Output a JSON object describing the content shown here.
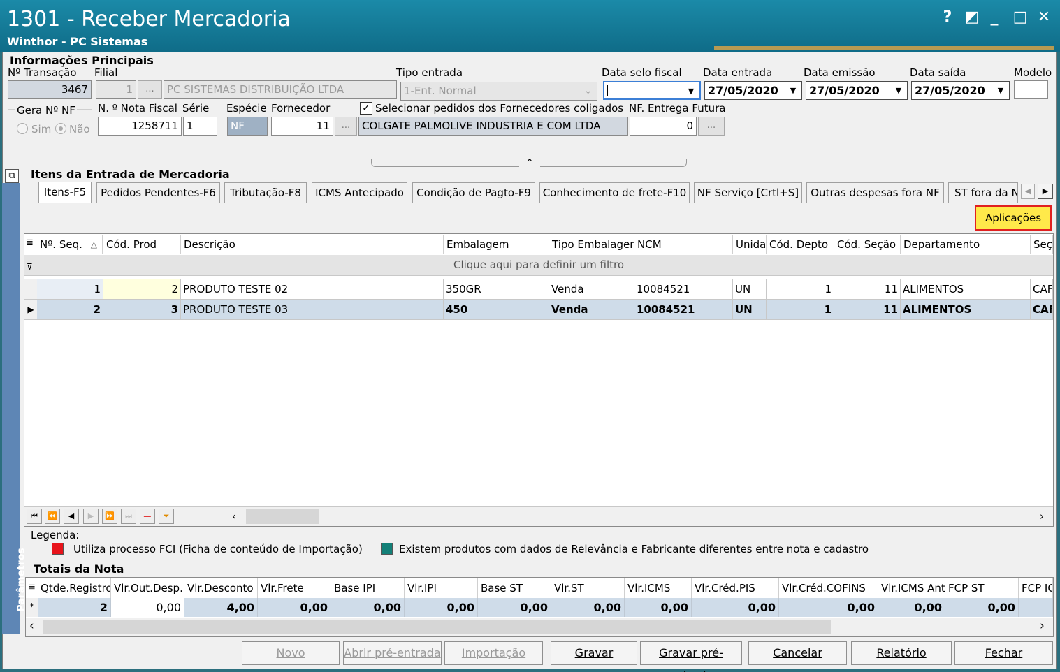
{
  "window": {
    "title": "1301 - Receber Mercadoria",
    "subtitle": "Winthor - PC Sistemas",
    "help": "?",
    "restore": "◩",
    "minimize": "_",
    "maximize": "□",
    "close": "✕"
  },
  "info": {
    "section_title": "Informações Principais",
    "transacao_label": "Nº Transação",
    "transacao_value": "3467",
    "filial_label": "Filial",
    "filial_value": "1",
    "filial_name": "PC SISTEMAS DISTRIBUIÇÃO LTDA",
    "tipo_entrada_label": "Tipo entrada",
    "tipo_entrada_value": "1-Ent. Normal",
    "data_selo_label": "Data selo fiscal",
    "data_selo_value": "",
    "data_entrada_label": "Data entrada",
    "data_entrada_value": "27/05/2020",
    "data_emissao_label": "Data emissão",
    "data_emissao_value": "27/05/2020",
    "data_saida_label": "Data saída",
    "data_saida_value": "27/05/2020",
    "modelo_label": "Modelo",
    "modelo_value": "",
    "gera_nf_label": "Gera Nº NF",
    "sim_label": "Sim",
    "nao_label": "Não",
    "nota_label": "N. º Nota Fiscal",
    "nota_value": "1258711",
    "serie_label": "Série",
    "serie_value": "1",
    "especie_label": "Espécie",
    "especie_value": "NF",
    "fornecedor_label": "Fornecedor",
    "fornecedor_value": "11",
    "fornecedor_name": "COLGATE PALMOLIVE INDUSTRIA  E COM LTDA",
    "coligados_label": "Selecionar pedidos dos Fornecedores coligados",
    "nf_futura_label": "NF. Entrega Futura",
    "nf_futura_value": "0",
    "ellipsis": "..."
  },
  "items": {
    "section_title": "Itens da Entrada de Mercadoria",
    "tabs": [
      "Itens-F5",
      "Pedidos Pendentes-F6",
      "Tributação-F8",
      "ICMS Antecipado",
      "Condição de Pagto-F9",
      "Conhecimento de frete-F10",
      "NF Serviço [Crtl+S]",
      "Outras despesas fora NF",
      "ST fora da N"
    ],
    "aplicacoes": "Aplicações",
    "filter_text": "Clique aqui para definir um filtro",
    "columns": [
      "Nº. Seq.",
      "Cód. Prod",
      "Descrição",
      "Embalagem",
      "Tipo Embalagem",
      "NCM",
      "Unida",
      "Cód. Depto",
      "Cód. Seção",
      "Departamento",
      "Seç"
    ],
    "rows": [
      [
        "1",
        "2",
        "PRODUTO TESTE 02",
        "350GR",
        "Venda",
        "10084521",
        "UN",
        "1",
        "11",
        "ALIMENTOS",
        "CAF"
      ],
      [
        "2",
        "3",
        "PRODUTO TESTE 03",
        "450",
        "Venda",
        "10084521",
        "UN",
        "1",
        "11",
        "ALIMENTOS",
        "CAF"
      ]
    ]
  },
  "legend": {
    "title": "Legenda:",
    "fci": "Utiliza processo FCI (Ficha de conteúdo de Importação)",
    "relevancia": "Existem produtos com dados de Relevância e Fabricante diferentes entre nota e cadastro",
    "fci_color": "#e8141b",
    "relevancia_color": "#138078"
  },
  "totais": {
    "title": "Totais da Nota",
    "columns": [
      "Qtde.Registro",
      "Vlr.Out.Desp.",
      "Vlr.Desconto",
      "Vlr.Frete",
      "Base IPI",
      "Vlr.IPI",
      "Base ST",
      "Vlr.ST",
      "Vlr.ICMS",
      "Vlr.Créd.PIS",
      "Vlr.Créd.COFINS",
      "Vlr.ICMS Ant",
      "FCP ST",
      "FCP IC"
    ],
    "values": [
      "2",
      "0,00",
      "4,00",
      "0,00",
      "0,00",
      "0,00",
      "0,00",
      "0,00",
      "0,00",
      "0,00",
      "0,00",
      "0,00",
      "0,00",
      ""
    ]
  },
  "side_label": "Parâmetros",
  "buttons": {
    "novo": "Novo",
    "abrir": "Abrir pré-entrada",
    "importacao": "Importação",
    "gravar": "Gravar",
    "gravar_pre": "Gravar pré-entrada",
    "cancelar": "Cancelar",
    "relatorio": "Relatório",
    "fechar": "Fechar"
  }
}
